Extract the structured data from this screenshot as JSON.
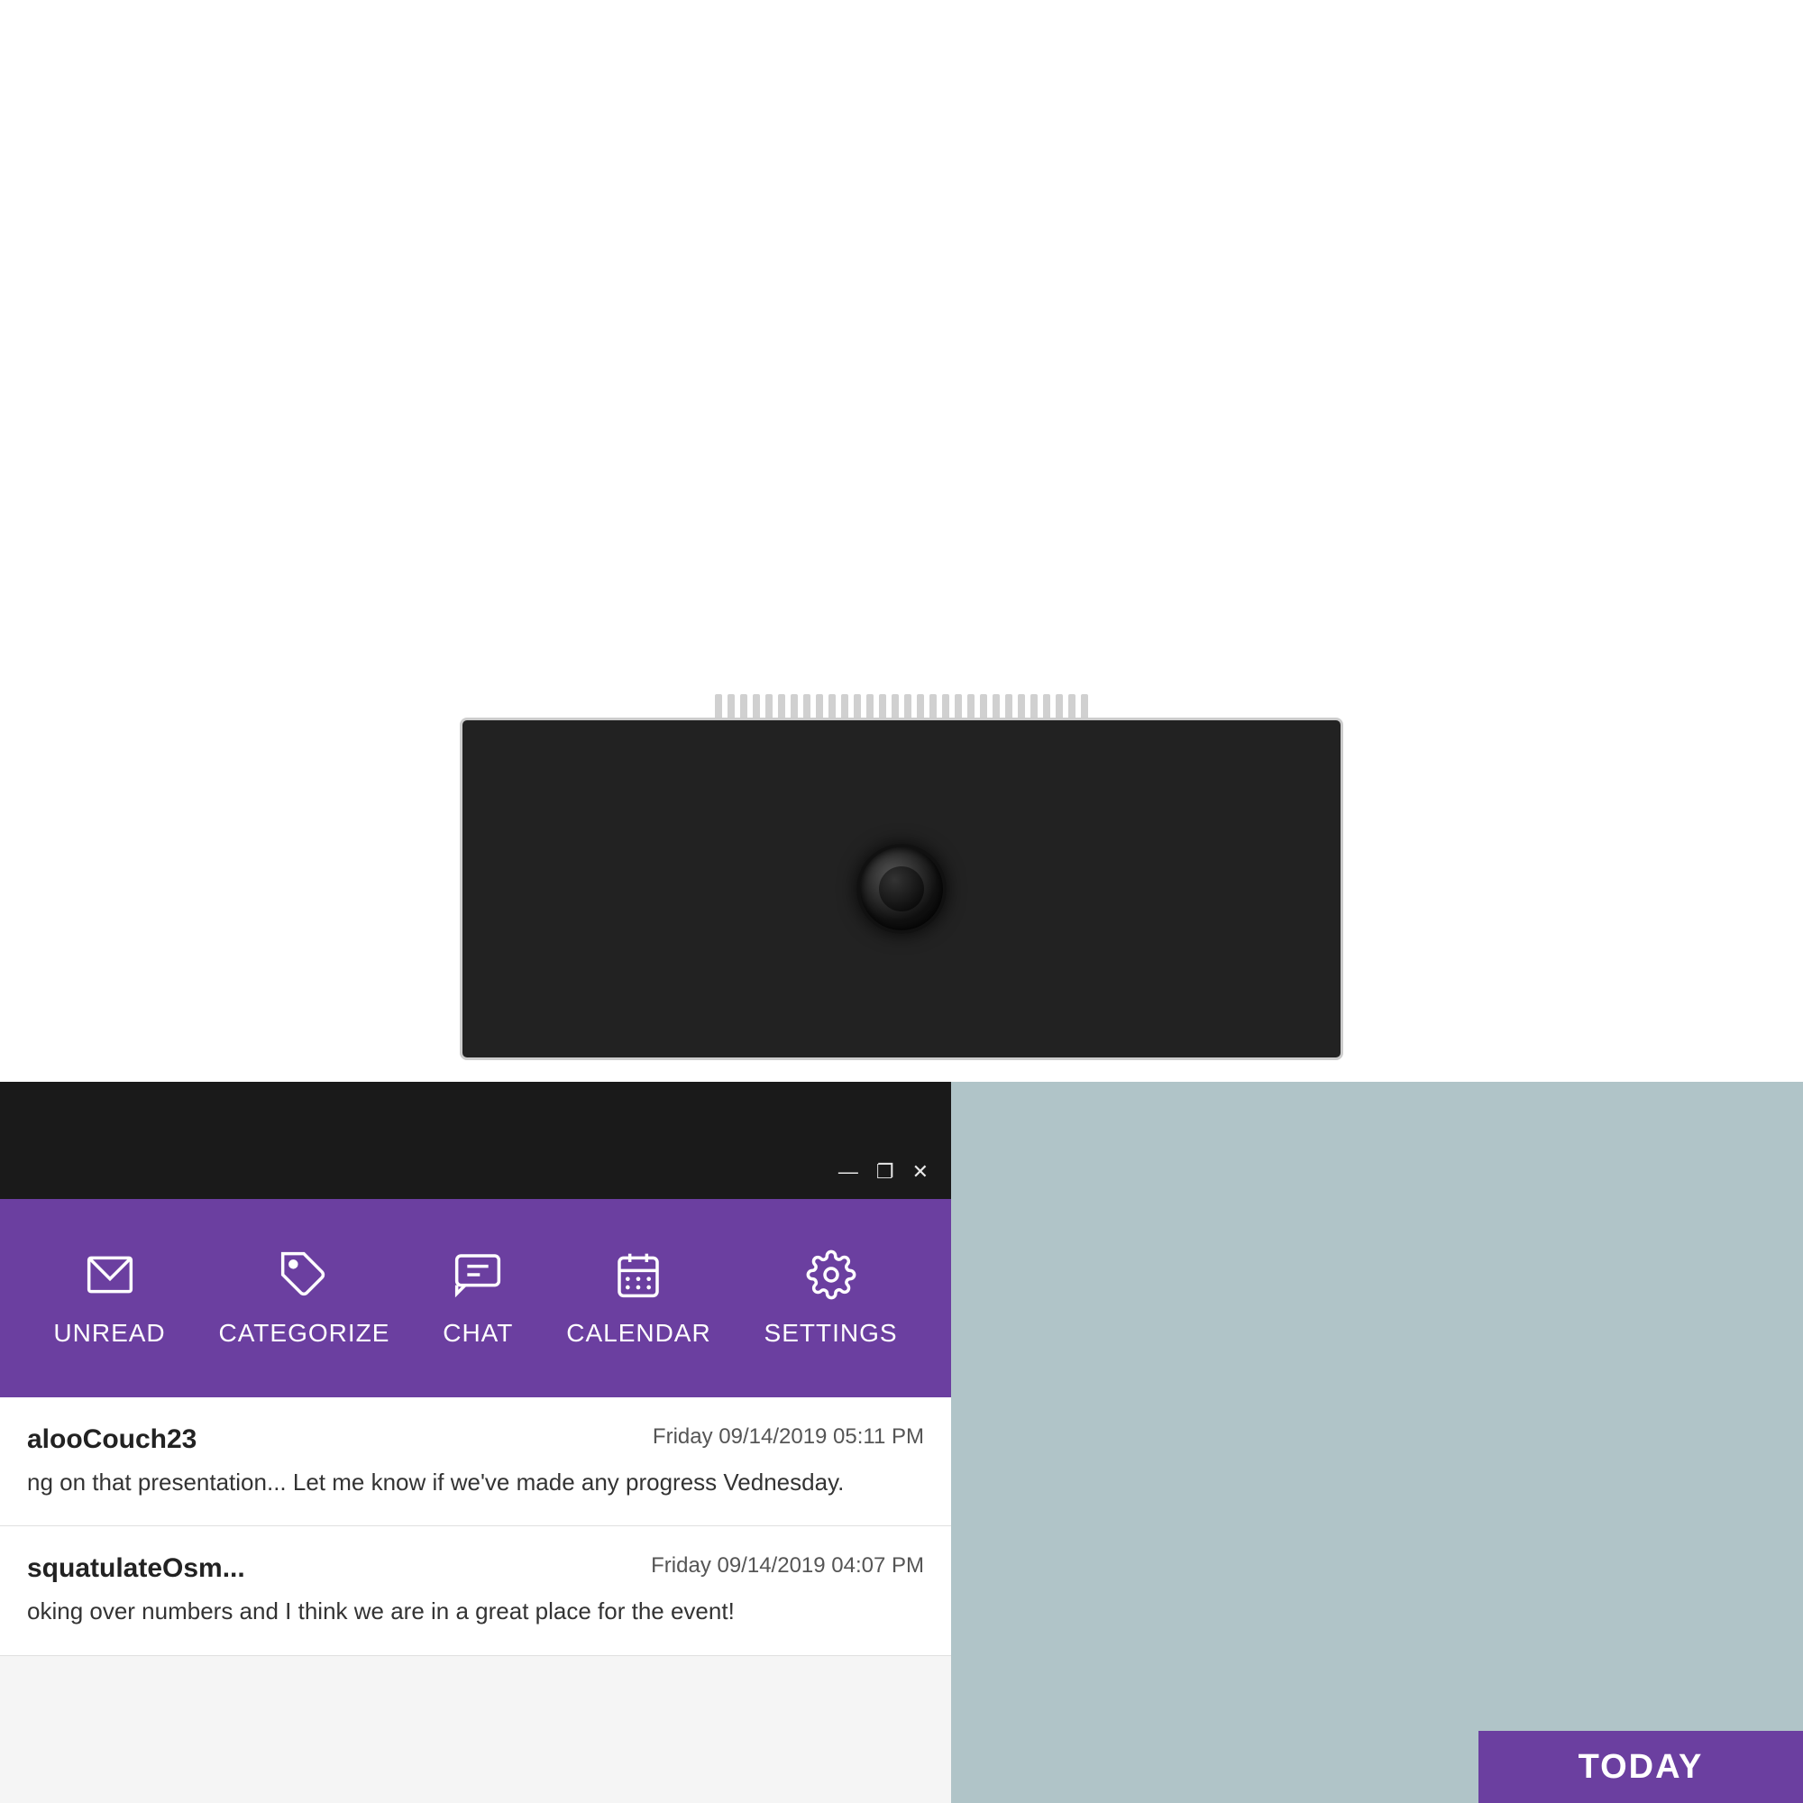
{
  "top_area": {
    "background": "#ffffff"
  },
  "monitor": {
    "teeth_count": 30,
    "camera_alt": "webcam"
  },
  "titlebar": {
    "minimize_label": "—",
    "restore_label": "❐",
    "close_label": "✕"
  },
  "navbar": {
    "items": [
      {
        "id": "unread",
        "label": "UNREAD",
        "icon": "envelope"
      },
      {
        "id": "categorize",
        "label": "CATEGORIZE",
        "icon": "tag"
      },
      {
        "id": "chat",
        "label": "CHAT",
        "icon": "chat"
      },
      {
        "id": "calendar",
        "label": "CALENDAR",
        "icon": "calendar"
      },
      {
        "id": "settings",
        "label": "SETTINGS",
        "icon": "gear"
      }
    ]
  },
  "messages": [
    {
      "sender": "alooCouch23",
      "time": "Friday 09/14/2019 05:11 PM",
      "preview": "ng on that presentation... Let me know if we've made any progress\nVednesday."
    },
    {
      "sender": "squatulateOsm...",
      "time": "Friday 09/14/2019 04:07 PM",
      "preview": "oking over numbers and I think we are in a great place for the event!"
    }
  ],
  "calendar": {
    "today_label": "TODAY"
  }
}
